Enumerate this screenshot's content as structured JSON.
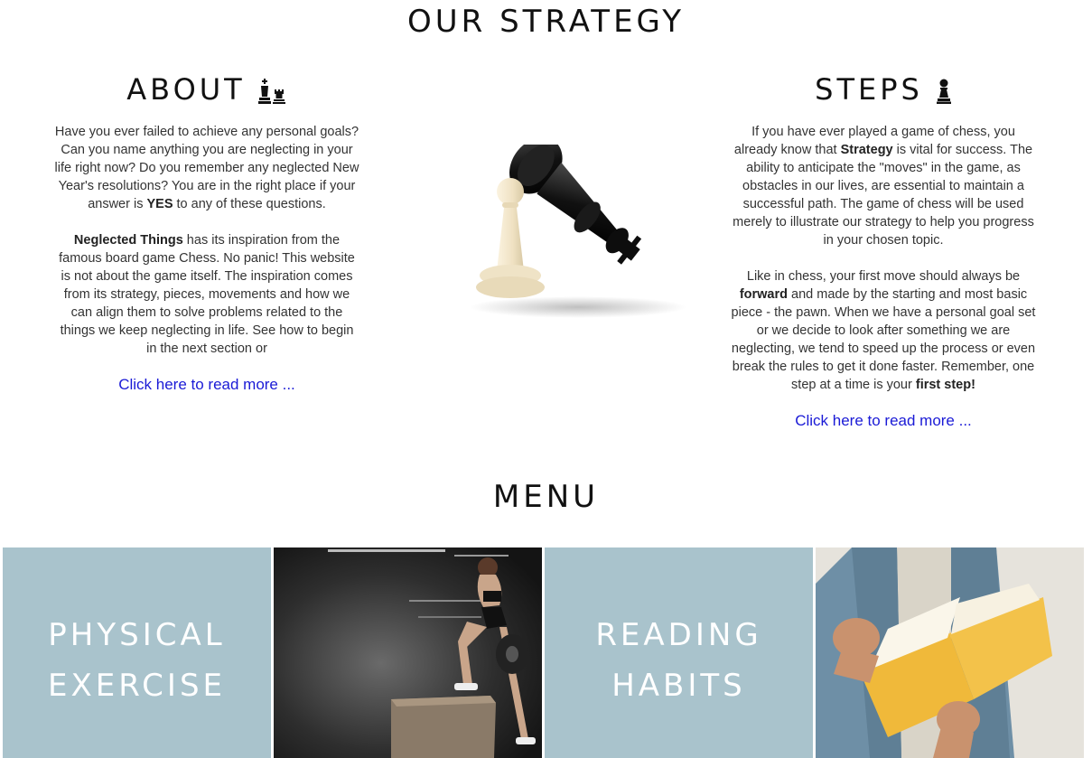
{
  "strategy": {
    "title": "OUR STRATEGY",
    "about": {
      "heading": "ABOUT",
      "icon": "chess-king-rook-icon",
      "p1": "Have you ever failed to achieve any personal goals? Can you name anything you are neglecting in your life right now? Do you remember any neglected New Year's resolutions? You are in the right place if your answer is ",
      "p1_bold": "YES",
      "p1_end": " to any of these questions.",
      "p2_bold": "Neglected Things",
      "p2": " has its inspiration from the famous board game Chess. No panic! This website is not about the game itself. The inspiration comes from its strategy, pieces, movements and how we can align them to solve problems related to the things we keep neglecting in life. See how to begin in the next section or",
      "link": "Click here to read more ..."
    },
    "steps": {
      "heading": "STEPS",
      "icon": "chess-pawn-icon",
      "p1a": "If you have ever played a game of chess, you already know that ",
      "p1_bold": "Strategy",
      "p1b": " is vital for success. The ability to anticipate the \"moves\" in the game, as obstacles in our lives, are essential to maintain a successful path. The game of chess will be used merely to illustrate our strategy to help you progress in your chosen topic.",
      "p2a": "Like in chess, your first move should always be ",
      "p2_bold1": "forward",
      "p2b": " and made by the starting and most basic piece - the pawn. When we have a personal goal set or we decide to look after something we are neglecting, we tend to speed up the process or even break the rules to get it done faster. Remember, one step at a time is your ",
      "p2_bold2": "first step!",
      "link": "Click here to read more ..."
    }
  },
  "menu": {
    "title": "MENU",
    "tiles": [
      {
        "line1": "PHYSICAL",
        "line2": "EXERCISE"
      },
      {
        "image": "woman-box-jump-photo"
      },
      {
        "line1": "READING",
        "line2": "HABITS"
      },
      {
        "image": "man-reading-book-photo"
      }
    ]
  },
  "colors": {
    "tile_bg": "#a9c3cc",
    "link": "#1a1ad6"
  }
}
